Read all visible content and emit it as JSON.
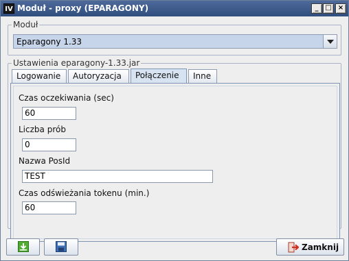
{
  "window": {
    "app_icon_text": "IV",
    "title": "Moduł - proxy (EPARAGONY)",
    "minimize_glyph": "_",
    "maximize_glyph": "□",
    "close_glyph": "×"
  },
  "module_group": {
    "legend": "Moduł",
    "selected": "Eparagony 1.33"
  },
  "settings_group": {
    "legend": "Ustawienia eparagony-1.33.jar"
  },
  "tabs": [
    {
      "label": "Logowanie",
      "active": false
    },
    {
      "label": "Autoryzacja",
      "active": false
    },
    {
      "label": "Połączenie",
      "active": true
    },
    {
      "label": "Inne",
      "active": false
    }
  ],
  "fields": {
    "timeout": {
      "label": "Czas oczekiwania (sec)",
      "value": "60"
    },
    "attempts": {
      "label": "Liczba prób",
      "value": "0"
    },
    "posid": {
      "label": "Nazwa PosId",
      "value": "TEST"
    },
    "token_refresh": {
      "label": "Czas odświeżania tokenu (min.)",
      "value": "60"
    }
  },
  "buttons": {
    "download_icon": "download-icon",
    "save_icon": "save-icon",
    "close_label": "Zamknij",
    "close_icon": "exit-icon"
  },
  "colors": {
    "titlebar": "#2f4d7e",
    "combo_bg": "#c7d5ea",
    "active_tab": "#d8e3f1"
  }
}
